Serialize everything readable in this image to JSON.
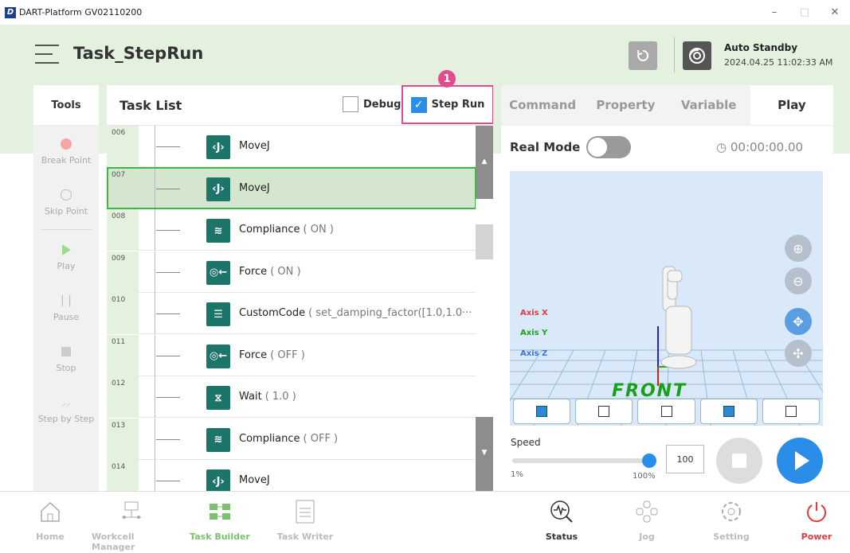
{
  "window": {
    "title": "DART-Platform GV02110200",
    "logo": "D"
  },
  "header": {
    "title": "Task_StepRun",
    "status": "Auto Standby",
    "datetime": "2024.04.25 11:02:33 AM"
  },
  "tools": {
    "heading": "Tools",
    "items": [
      {
        "label": "Break Point",
        "icon": "record-dot-icon"
      },
      {
        "label": "Skip Point",
        "icon": "circle-icon"
      },
      {
        "label": "Play",
        "icon": "play-icon"
      },
      {
        "label": "Pause",
        "icon": "pause-icon"
      },
      {
        "label": "Stop",
        "icon": "stop-icon"
      },
      {
        "label": "Step by Step",
        "icon": "step-icon"
      }
    ]
  },
  "tasklist": {
    "heading": "Task List",
    "debug_label": "Debug",
    "step_run_label": "Step Run",
    "step_run_checked": true,
    "marker": "1",
    "rows": [
      {
        "num": "006",
        "name": "MoveJ",
        "arg": "",
        "icon": "movej-icon"
      },
      {
        "num": "007",
        "name": "MoveJ",
        "arg": "",
        "icon": "movej-icon",
        "selected": true
      },
      {
        "num": "008",
        "name": "Compliance",
        "arg": "( ON )",
        "icon": "compliance-icon"
      },
      {
        "num": "009",
        "name": "Force",
        "arg": "( ON )",
        "icon": "force-icon"
      },
      {
        "num": "010",
        "name": "CustomCode",
        "arg": "( set_damping_factor([1.0,1.0··· )",
        "icon": "customcode-icon"
      },
      {
        "num": "011",
        "name": "Force",
        "arg": "( OFF )",
        "icon": "force-icon"
      },
      {
        "num": "012",
        "name": "Wait",
        "arg": "( 1.0 )",
        "icon": "wait-icon"
      },
      {
        "num": "013",
        "name": "Compliance",
        "arg": "( OFF )",
        "icon": "compliance-icon"
      },
      {
        "num": "014",
        "name": "MoveJ",
        "arg": "",
        "icon": "movej-icon"
      }
    ]
  },
  "right": {
    "tabs": [
      "Command",
      "Property",
      "Variable",
      "Play"
    ],
    "active_tab": "Play",
    "real_mode_label": "Real Mode",
    "real_mode_on": false,
    "timer": "00:00:00.00",
    "axes": [
      "Axis X",
      "Axis Y",
      "Axis Z"
    ],
    "front_label": "FRONT",
    "speed_label": "Speed",
    "speed_min": "1%",
    "speed_max": "100%",
    "speed_value": "100",
    "speed_fraction": 1.0
  },
  "bottom": [
    {
      "label": "Home",
      "icon": "home-icon"
    },
    {
      "label": "Workcell Manager",
      "icon": "workcell-icon"
    },
    {
      "label": "Task Builder",
      "icon": "task-builder-icon"
    },
    {
      "label": "Task Writer",
      "icon": "task-writer-icon"
    },
    {
      "label": "Status",
      "icon": "status-icon"
    },
    {
      "label": "Jog",
      "icon": "jog-icon"
    },
    {
      "label": "Setting",
      "icon": "gear-icon"
    },
    {
      "label": "Power",
      "icon": "power-icon"
    }
  ],
  "colors": {
    "accent_green": "#3db64a",
    "header_bg": "#e4f1df",
    "marker_pink": "#e04c8e",
    "play_blue": "#2a8ee8",
    "cmd_teal": "#1d7468"
  }
}
